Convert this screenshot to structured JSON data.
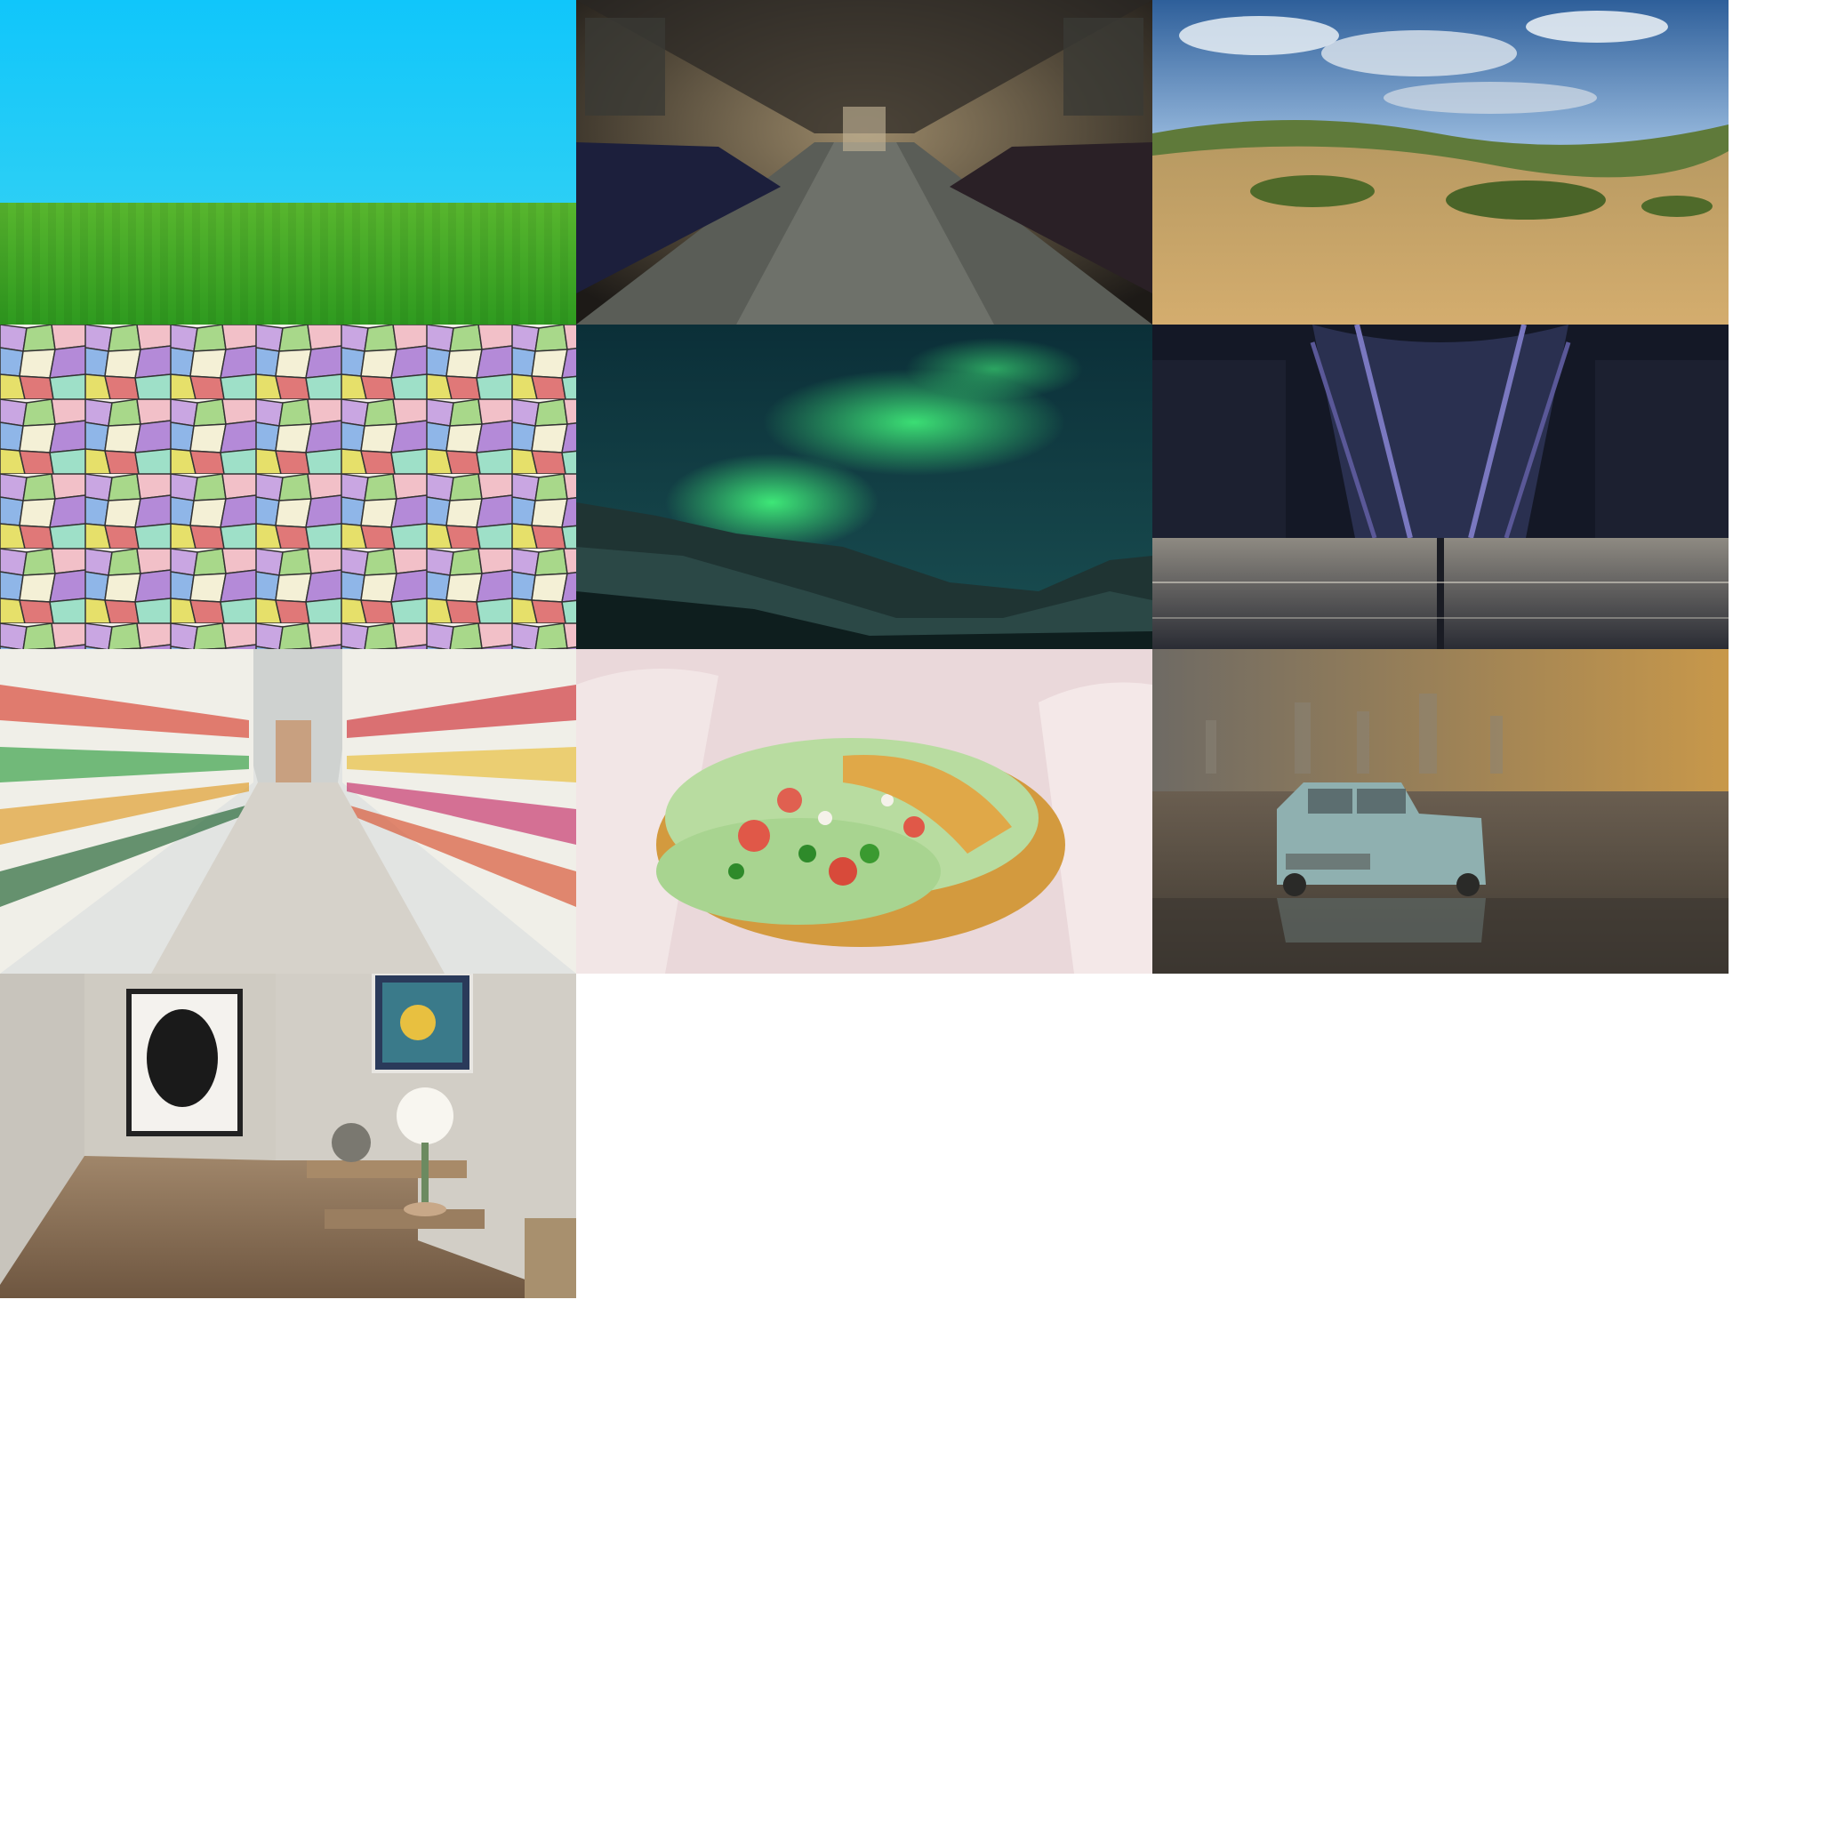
{
  "gallery": {
    "background": "#ffffff",
    "tiles": [
      {
        "icon": "grass-field-under-blue-sky",
        "colors": [
          "#12c8fb",
          "#3ea325"
        ]
      },
      {
        "icon": "empty-tram-interior",
        "colors": [
          "#2b2723",
          "#6a5c48"
        ]
      },
      {
        "icon": "rolling-wheat-hills-under-clouds",
        "colors": [
          "#5c8fc4",
          "#c8a264"
        ]
      },
      {
        "icon": "colorful-voronoi-mosaic",
        "colors": [
          "#d8b6e6",
          "#a4d686"
        ]
      },
      {
        "icon": "aurora-over-snowy-mountains",
        "colors": [
          "#103c3e",
          "#36e070"
        ]
      },
      {
        "icon": "glass-atrium-corridor-at-night",
        "colors": [
          "#161b2b",
          "#5f5a88"
        ]
      },
      {
        "icon": "supermarket-aisle",
        "colors": [
          "#d8dad8",
          "#c63a32"
        ]
      },
      {
        "icon": "tacos-on-paper",
        "colors": [
          "#e8d6d6",
          "#d0943a"
        ]
      },
      {
        "icon": "toy-car-on-wet-beach",
        "colors": [
          "#7a7468",
          "#8aa8a8"
        ]
      },
      {
        "icon": "modern-hallway-interior",
        "colors": [
          "#cfcac2",
          "#8a6e52"
        ]
      }
    ]
  }
}
